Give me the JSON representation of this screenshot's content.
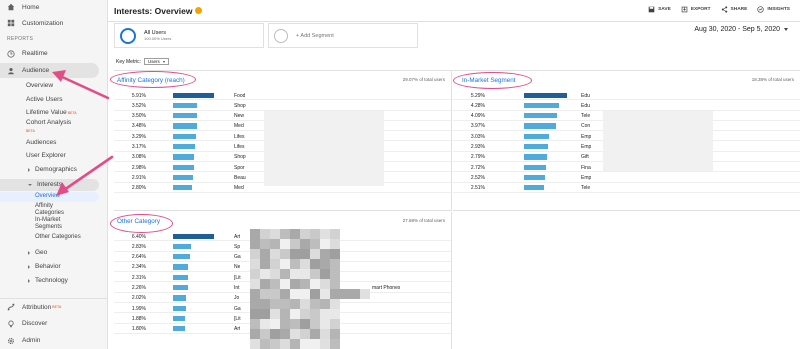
{
  "sidebar": {
    "top": [
      {
        "label": "Home",
        "icon": "home-icon"
      },
      {
        "label": "Customization",
        "icon": "customization-icon"
      }
    ],
    "section": "REPORTS",
    "realtime": "Realtime",
    "audience": "Audience",
    "audience_items": [
      "Overview",
      "Active Users"
    ],
    "lifetime_value": "Lifetime Value",
    "cohort_analysis": "Cohort Analysis",
    "beta": "BETA",
    "audience_items2": [
      "Audiences",
      "User Explorer"
    ],
    "demographics": "Demographics",
    "interests": "Interests",
    "interests_items": [
      "Overview",
      "Affinity Categories",
      "In-Market Segments",
      "Other Categories"
    ],
    "groups": [
      "Geo",
      "Behavior",
      "Technology"
    ],
    "bottom": [
      {
        "label": "Attribution",
        "icon": "attribution-icon"
      },
      {
        "label": "Discover",
        "icon": "discover-icon"
      },
      {
        "label": "Admin",
        "icon": "admin-icon"
      }
    ]
  },
  "header": {
    "title": "Interests: Overview",
    "actions": [
      "SAVE",
      "EXPORT",
      "SHARE",
      "INSIGHTS"
    ]
  },
  "segments": {
    "all_users": "All Users",
    "all_users_pct": "100.00% Users",
    "add_segment": "+ Add Segment"
  },
  "date_range": "Aug 30, 2020 - Sep 5, 2020",
  "key_metric": {
    "label": "Key Metric:",
    "value": "Users"
  },
  "panels": {
    "affinity": {
      "title": "Affinity Category (reach)",
      "meta": "29.07% of total users",
      "rows": [
        {
          "pct": "5.91%",
          "share": 5.91,
          "label": "Food"
        },
        {
          "pct": "3.52%",
          "share": 3.52,
          "label": "Shop"
        },
        {
          "pct": "3.50%",
          "share": 3.5,
          "label": "New"
        },
        {
          "pct": "3.48%",
          "share": 3.48,
          "label": "Med"
        },
        {
          "pct": "3.29%",
          "share": 3.29,
          "label": "Lifes"
        },
        {
          "pct": "3.17%",
          "share": 3.17,
          "label": "Lifes"
        },
        {
          "pct": "3.08%",
          "share": 3.08,
          "label": "Shop"
        },
        {
          "pct": "2.98%",
          "share": 2.98,
          "label": "Spor"
        },
        {
          "pct": "2.91%",
          "share": 2.91,
          "label": "Beau"
        },
        {
          "pct": "2.80%",
          "share": 2.8,
          "label": "Med"
        }
      ]
    },
    "inmarket": {
      "title": "In-Market Segment",
      "meta": "18.38% of total users",
      "rows": [
        {
          "pct": "5.29%",
          "share": 5.29,
          "label": "Edu"
        },
        {
          "pct": "4.28%",
          "share": 4.28,
          "label": "Edu"
        },
        {
          "pct": "4.09%",
          "share": 4.09,
          "label": "Tele"
        },
        {
          "pct": "3.97%",
          "share": 3.97,
          "label": "Con"
        },
        {
          "pct": "3.03%",
          "share": 3.03,
          "label": "Emp"
        },
        {
          "pct": "2.93%",
          "share": 2.93,
          "label": "Emp"
        },
        {
          "pct": "2.79%",
          "share": 2.79,
          "label": "Gift"
        },
        {
          "pct": "2.72%",
          "share": 2.72,
          "label": "Fina"
        },
        {
          "pct": "2.52%",
          "share": 2.52,
          "label": "Emp"
        },
        {
          "pct": "2.51%",
          "share": 2.51,
          "label": "Tele"
        }
      ]
    },
    "other": {
      "title": "Other Category",
      "meta": "27.68% of total users",
      "rows": [
        {
          "pct": "6.40%",
          "share": 6.4,
          "label": "Art"
        },
        {
          "pct": "2.83%",
          "share": 2.83,
          "label": "Sp"
        },
        {
          "pct": "2.64%",
          "share": 2.64,
          "label": "Ga"
        },
        {
          "pct": "2.34%",
          "share": 2.34,
          "label": "Ne"
        },
        {
          "pct": "2.31%",
          "share": 2.31,
          "label": "[Lit"
        },
        {
          "pct": "2.26%",
          "share": 2.26,
          "label": "Int",
          "tail": "mart Phones"
        },
        {
          "pct": "2.02%",
          "share": 2.02,
          "label": "Jo"
        },
        {
          "pct": "1.99%",
          "share": 1.99,
          "label": "Ga"
        },
        {
          "pct": "1.88%",
          "share": 1.88,
          "label": "[Lit"
        },
        {
          "pct": "1.80%",
          "share": 1.8,
          "label": "Art"
        }
      ]
    }
  },
  "colors": {
    "bar_top": "#1f5f99",
    "bar": "#50aadb",
    "annotation": "#e24d88",
    "link": "#1a73e8"
  }
}
